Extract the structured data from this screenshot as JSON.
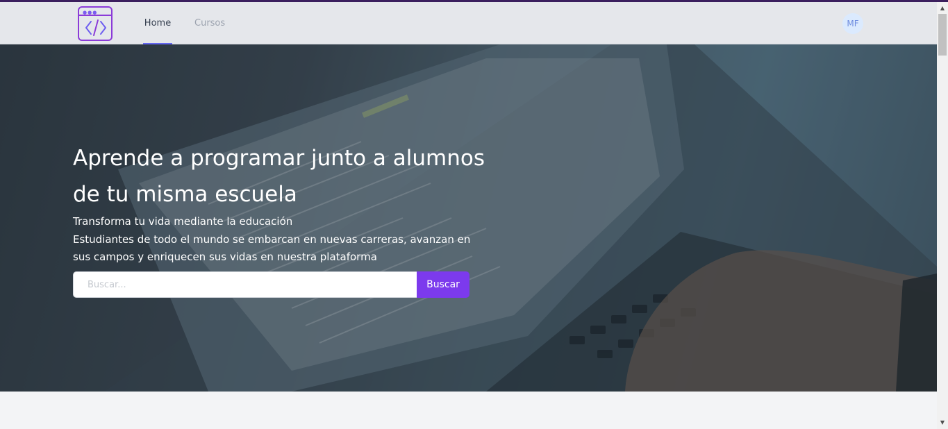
{
  "nav": {
    "logo_icon": "code-window-icon",
    "links": [
      {
        "label": "Home",
        "active": true
      },
      {
        "label": "Cursos",
        "active": false
      }
    ],
    "avatar_initials": "MF"
  },
  "hero": {
    "title": "Aprende a programar junto a alumnos de tu misma escuela",
    "subtitle_line1": "Transforma tu vida mediante la educación",
    "subtitle_line2": "Estudiantes de todo el mundo se embarcan en nuevas carreras, avanzan en sus campos y enriquecen sus vidas en nuestra plataforma",
    "background_image": "laptop-code-photo"
  },
  "search": {
    "placeholder": "Buscar...",
    "value": "",
    "button_label": "Buscar"
  },
  "colors": {
    "accent": "#7c3aed",
    "nav_active": "#6366f1",
    "navbar_bg": "#e5e7eb"
  }
}
